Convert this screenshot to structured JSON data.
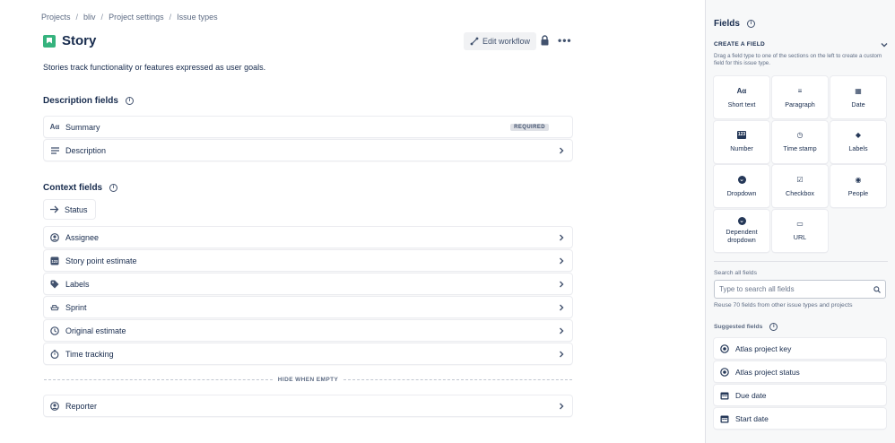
{
  "breadcrumb": [
    "Projects",
    "bliv",
    "Project settings",
    "Issue types"
  ],
  "page": {
    "title": "Story",
    "description": "Stories track functionality or features expressed as user goals.",
    "edit_workflow": "Edit workflow"
  },
  "description_fields": {
    "heading": "Description fields",
    "items": [
      {
        "label": "Summary",
        "badge": "REQUIRED",
        "icon": "text-icon"
      },
      {
        "label": "Description",
        "icon": "paragraph-icon"
      }
    ]
  },
  "context_fields": {
    "heading": "Context fields",
    "status": "Status",
    "items": [
      {
        "label": "Assignee",
        "icon": "person-icon"
      },
      {
        "label": "Story point estimate",
        "icon": "number-icon"
      },
      {
        "label": "Labels",
        "icon": "tag-icon"
      },
      {
        "label": "Sprint",
        "icon": "sprint-icon"
      },
      {
        "label": "Original estimate",
        "icon": "clock-icon"
      },
      {
        "label": "Time tracking",
        "icon": "stopwatch-icon"
      }
    ],
    "hide_when_empty": "HIDE WHEN EMPTY",
    "hidden_items": [
      {
        "label": "Reporter",
        "icon": "person-icon"
      }
    ]
  },
  "sidebar": {
    "title": "Fields",
    "create_heading": "CREATE A FIELD",
    "create_hint": "Drag a field type to one of the sections on the left to create a custom field for this issue type.",
    "field_types": [
      {
        "label": "Short text",
        "icon": "short-text-icon",
        "glyph": "Aα"
      },
      {
        "label": "Paragraph",
        "icon": "paragraph-icon",
        "glyph": "≡"
      },
      {
        "label": "Date",
        "icon": "calendar-icon",
        "glyph": "▦"
      },
      {
        "label": "Number",
        "icon": "number-icon",
        "glyph": "123"
      },
      {
        "label": "Time stamp",
        "icon": "clock-icon",
        "glyph": "◷"
      },
      {
        "label": "Labels",
        "icon": "tag-icon",
        "glyph": "◆"
      },
      {
        "label": "Dropdown",
        "icon": "dropdown-icon",
        "glyph": "⌄"
      },
      {
        "label": "Checkbox",
        "icon": "checkbox-icon",
        "glyph": "☑"
      },
      {
        "label": "People",
        "icon": "person-icon",
        "glyph": "◉"
      },
      {
        "label": "Dependent dropdown",
        "icon": "dependent-dropdown-icon",
        "glyph": "⌄"
      },
      {
        "label": "URL",
        "icon": "url-icon",
        "glyph": "▭"
      }
    ],
    "search_label": "Search all fields",
    "search_placeholder": "Type to search all fields",
    "reuse_text": "Reuse 70 fields from other issue types and projects",
    "suggested_heading": "Suggested fields",
    "suggested": [
      {
        "label": "Atlas project key",
        "icon": "atlas-icon"
      },
      {
        "label": "Atlas project status",
        "icon": "atlas-icon"
      },
      {
        "label": "Due date",
        "icon": "calendar-icon"
      },
      {
        "label": "Start date",
        "icon": "calendar-icon"
      }
    ]
  }
}
